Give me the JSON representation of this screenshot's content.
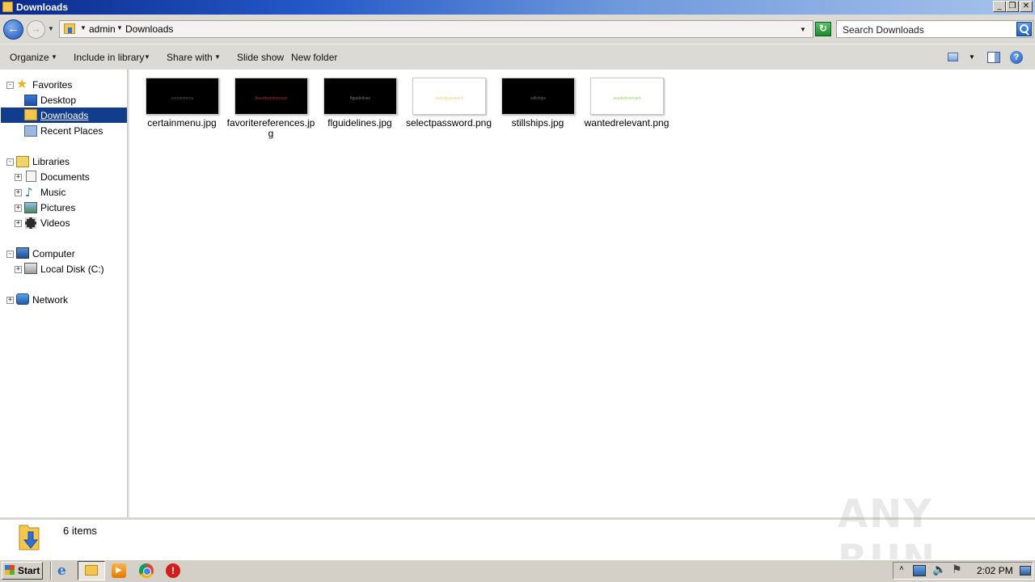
{
  "window": {
    "title": "Downloads",
    "controls": {
      "minimize": "_",
      "restore": "❐",
      "close": "✕"
    }
  },
  "address": {
    "crumbs": [
      "admin",
      "Downloads"
    ],
    "search_placeholder": "Search Downloads"
  },
  "toolbar": {
    "organize": "Organize",
    "include_in_library": "Include in library",
    "share_with": "Share with",
    "slide_show": "Slide show",
    "new_folder": "New folder"
  },
  "nav": {
    "favorites": {
      "label": "Favorites",
      "items": [
        "Desktop",
        "Downloads",
        "Recent Places"
      ]
    },
    "libraries": {
      "label": "Libraries",
      "items": [
        "Documents",
        "Music",
        "Pictures",
        "Videos"
      ]
    },
    "computer": {
      "label": "Computer",
      "items": [
        "Local Disk (C:)"
      ]
    },
    "network": {
      "label": "Network"
    },
    "selected": "Downloads"
  },
  "files": [
    {
      "name": "certainmenu.jpg",
      "thumb_bg": "#000000",
      "thumb_text": "certainmenu",
      "thumb_text_color": "#555555"
    },
    {
      "name": "favoritereferences.jpg",
      "thumb_bg": "#000000",
      "thumb_text": "favoritereferences",
      "thumb_text_color": "#b0303a"
    },
    {
      "name": "flguidelines.jpg",
      "thumb_bg": "#000000",
      "thumb_text": "flguidelines",
      "thumb_text_color": "#777777"
    },
    {
      "name": "selectpassword.png",
      "thumb_bg": "#ffffff",
      "thumb_text": "selectpassword",
      "thumb_text_color": "#e6d27a"
    },
    {
      "name": "stillships.jpg",
      "thumb_bg": "#000000",
      "thumb_text": "stillships",
      "thumb_text_color": "#6d6d6d"
    },
    {
      "name": "wantedrelevant.png",
      "thumb_bg": "#ffffff",
      "thumb_text": "wantedrelevant",
      "thumb_text_color": "#9ad06a"
    }
  ],
  "status": {
    "items_count": "6 items"
  },
  "taskbar": {
    "start_label": "Start",
    "clock": "2:02 PM",
    "icons": [
      "internet-explorer-icon",
      "explorer-icon",
      "media-player-icon",
      "chrome-icon",
      "stop-icon"
    ]
  },
  "watermark": "ANY RUN",
  "colors": {
    "selection": "#123c8c",
    "chrome": "#dcdad5",
    "title_start": "#0b2a8a"
  }
}
